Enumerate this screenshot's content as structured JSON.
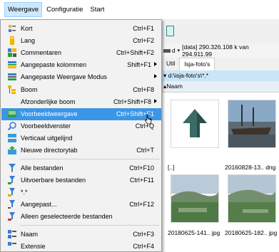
{
  "menubar": {
    "items": [
      "Weergave",
      "Configuratie",
      "Start"
    ]
  },
  "background": {
    "path_text": "[data]  290.326.108 k van 294.911.99",
    "tabs": [
      "Util",
      "Isja-foto's"
    ],
    "current_path": "d:\\isja-foto's\\*.*",
    "column": "Naam",
    "thumbs": [
      "[..]",
      "20160828-13.. dng",
      "20180625-141.. jpg",
      "20180625-182.. jpg"
    ]
  },
  "menu": {
    "items": [
      {
        "label": "Kort",
        "shortcut": "Ctrl+F1",
        "icon": "short-view-icon"
      },
      {
        "label": "Lang",
        "shortcut": "Ctrl+F2",
        "icon": "long-view-icon"
      },
      {
        "label": "Commentaren",
        "shortcut": "Ctrl+Shift+F2",
        "icon": "comments-icon"
      },
      {
        "label": "Aangepaste kolommen",
        "shortcut": "Shift+F1",
        "icon": "custom-columns-icon"
      },
      {
        "label": "Aangepaste Weergave Modus",
        "shortcut": "",
        "icon": "custom-view-mode-icon"
      },
      {
        "label": "Boom",
        "shortcut": "Ctrl+F8",
        "icon": "tree-icon"
      },
      {
        "label": "Afzonderlijke boom",
        "shortcut": "Ctrl+Shift+F8",
        "icon": ""
      },
      {
        "label": "Voorbeeldweergave",
        "shortcut": "Ctrl+Shift+F1",
        "icon": "thumbnail-view-icon"
      },
      {
        "label": "Voorbeeldvenster",
        "shortcut": "Ctrl+Q",
        "icon": "preview-window-icon"
      },
      {
        "label": "Verticaal uitgelijnd",
        "shortcut": "",
        "icon": "vertical-align-icon"
      },
      {
        "label": "Nieuwe directorytab",
        "shortcut": "Ctrl+T",
        "icon": "new-tab-icon"
      },
      {
        "label": "Alle bestanden",
        "shortcut": "Ctrl+F10",
        "icon": "all-files-icon"
      },
      {
        "label": "Uitvoerbare bestanden",
        "shortcut": "Ctrl+F11",
        "icon": "executables-icon"
      },
      {
        "label": "*.*",
        "shortcut": "",
        "icon": "wildcard-icon"
      },
      {
        "label": "Aangepast...",
        "shortcut": "Ctrl+F12",
        "icon": "custom-filter-icon"
      },
      {
        "label": "Alleen geselecteerde bestanden",
        "shortcut": "",
        "icon": "selected-files-icon"
      },
      {
        "label": "Naam",
        "shortcut": "Ctrl+F3",
        "icon": "sort-name-icon"
      },
      {
        "label": "Extensie",
        "shortcut": "Ctrl+F4",
        "icon": "sort-extension-icon"
      }
    ]
  }
}
